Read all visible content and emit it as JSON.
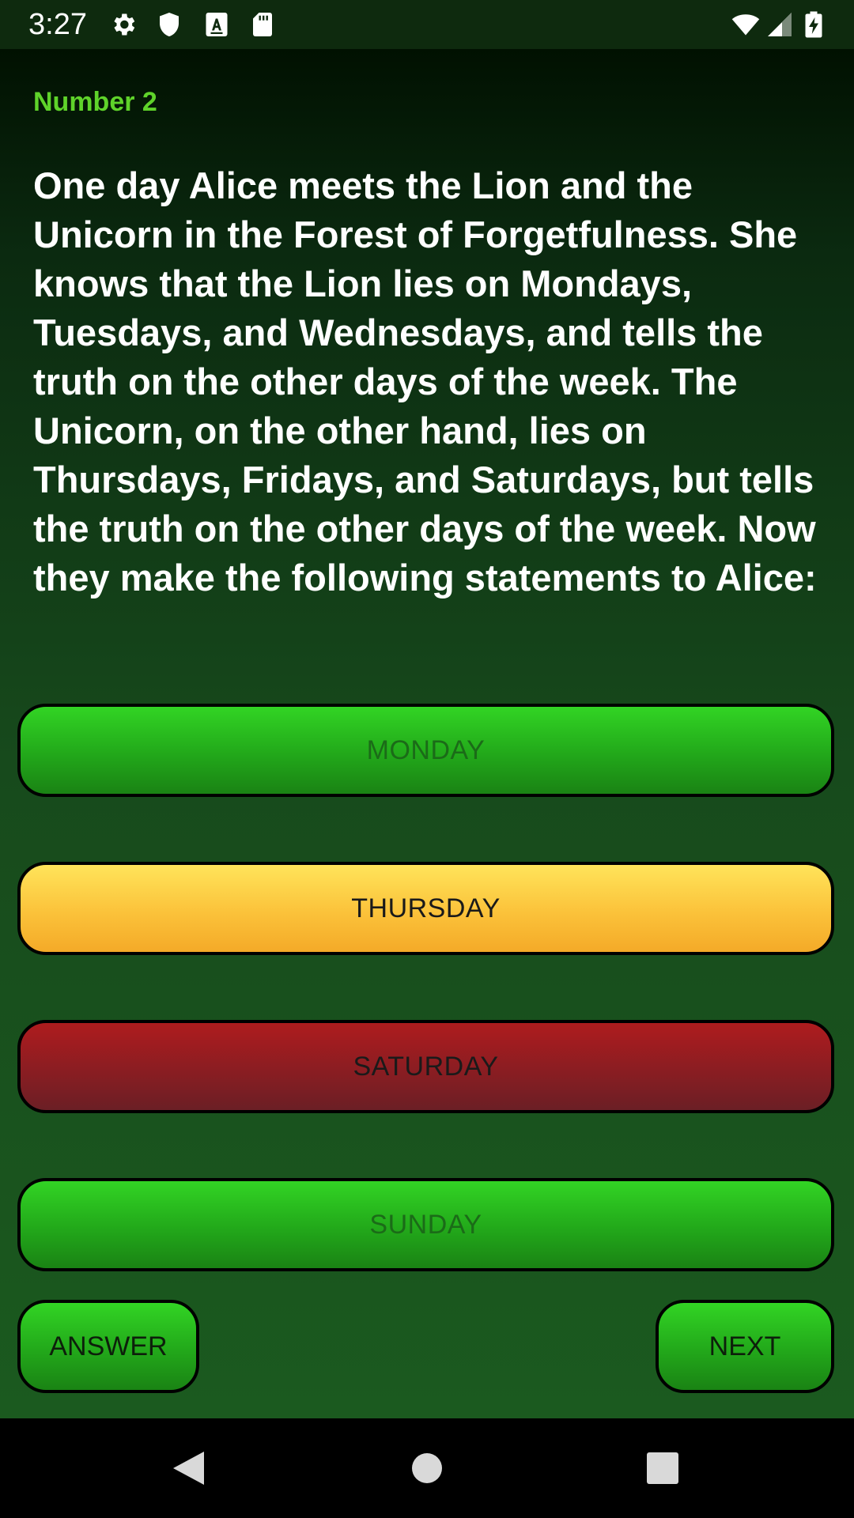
{
  "status_bar": {
    "time": "3:27",
    "icons_left": [
      "gear-icon",
      "shield-icon",
      "font-a-icon",
      "sd-card-icon"
    ],
    "icons_right": [
      "wifi-icon",
      "cell-signal-icon",
      "battery-charging-icon"
    ]
  },
  "question": {
    "number_label": "Number 2",
    "text": "One day Alice meets the Lion and the Unicorn in the Forest of Forgetfulness. She knows that the Lion lies on Mondays, Tuesdays, and Wednesdays, and tells the truth on the other days of the week. The Unicorn, on the other hand, lies on Thursdays, Fridays, and Saturdays, but tells the truth on the other days of the week. Now they make the following statements to Alice:"
  },
  "options": [
    {
      "label": "MONDAY",
      "color": "#22a81a",
      "text_color": "#1b6b18"
    },
    {
      "label": "THURSDAY",
      "color": "#fbc23a",
      "text_color": "#1a1a1a"
    },
    {
      "label": "SATURDAY",
      "color": "#8a1d22",
      "text_color": "#1a1a1a"
    },
    {
      "label": "SUNDAY",
      "color": "#22a81a",
      "text_color": "#1b6b18"
    }
  ],
  "actions": {
    "answer_label": "ANSWER",
    "next_label": "NEXT"
  },
  "nav_bar": {
    "icons": [
      "back-triangle-icon",
      "home-circle-icon",
      "recents-square-icon"
    ]
  },
  "colors": {
    "accent_green": "#5fd32a",
    "button_green": "#22a81a",
    "button_yellow": "#fbc23a",
    "button_red": "#8a1d22"
  }
}
